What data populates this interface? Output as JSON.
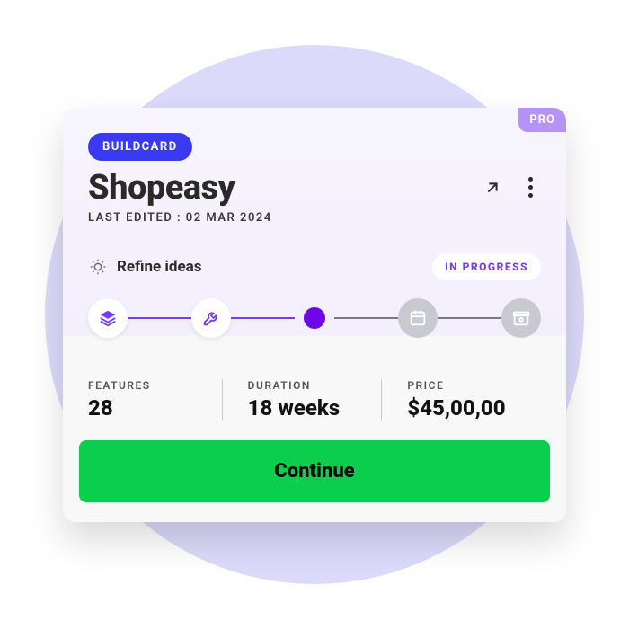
{
  "header": {
    "pill": "BUILDCARD",
    "pro": "PRO",
    "title": "Shopeasy",
    "last_edited": "LAST EDITED : 02 MAR 2024"
  },
  "refine": {
    "label": "Refine ideas",
    "status": "IN PROGRESS"
  },
  "stats": {
    "features_label": "FEATURES",
    "features_value": "28",
    "duration_label": "DURATION",
    "duration_value": "18 weeks",
    "price_label": "PRICE",
    "price_value": "$45,00,00"
  },
  "cta": {
    "continue": "Continue"
  }
}
